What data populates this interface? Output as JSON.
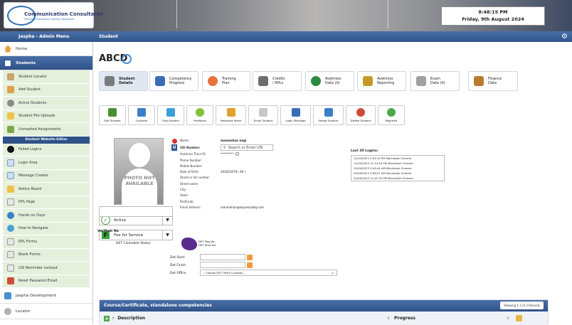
{
  "header": {
    "logo_line1": "Communication Consultants",
    "logo_line2": "Telecommunications Training Specialists",
    "time": "8:48:15 PM",
    "date": "Friday, 9th August 2024"
  },
  "sidebar": {
    "title": "Jaspha - Admin Menu",
    "home": "Home",
    "students": "Students",
    "items": [
      "Student Locator",
      "Add Student",
      "Active Students",
      "Student File Uploads",
      "Unmarked Assignments"
    ],
    "editor_label": "Student Website Editor",
    "editor_items": [
      "Failed Logins",
      "Login Area",
      "Message Creator",
      "Notice Board",
      "RPL Page",
      "Hands on Days",
      "How to Navigate",
      "RPL Forms",
      "Blank Forms",
      "USI Reminder Lockout",
      "Reset Password Email"
    ],
    "bottom": [
      "Jaspha Development",
      "Locator"
    ]
  },
  "main": {
    "section_title": "Student",
    "student_name": "ABCD",
    "tabs": [
      {
        "l1": "Student",
        "l2": "Details",
        "color": "#7b7b7b"
      },
      {
        "l1": "Competency",
        "l2": "Progress",
        "color": "#3a6db5"
      },
      {
        "l1": "Training",
        "l2": "Plan",
        "color": "#e8733a"
      },
      {
        "l1": "Credits",
        "l2": "/ RPLs",
        "color": "#6d6d6d"
      },
      {
        "l1": "Avetmiss",
        "l2": "Data (0)",
        "color": "#2b8a3e"
      },
      {
        "l1": "Avetmiss",
        "l2": "Reporting",
        "color": "#c59a28"
      },
      {
        "l1": "Exam",
        "l2": "Data (0)",
        "color": "#a0a0a0"
      },
      {
        "l1": "Finance",
        "l2": "Data",
        "color": "#b87b2e"
      }
    ],
    "actions": [
      {
        "label": "Edit Student",
        "color": "#4a8f2f"
      },
      {
        "label": "Contacts",
        "color": "#3a7fc7"
      },
      {
        "label": "Flag Student",
        "color": "#3a9fd8"
      },
      {
        "label": "Feedback",
        "color": "#7fc23a"
      },
      {
        "label": "Password Reset",
        "color": "#e0a32a"
      },
      {
        "label": "Email Student",
        "color": "#c7c7c7"
      },
      {
        "label": "Login Message",
        "color": "#3a6db5"
      },
      {
        "label": "Merge Student",
        "color": "#3a7fc7"
      },
      {
        "label": "Delete Student",
        "color": "#d04a3a"
      },
      {
        "label": "Migrated",
        "color": "#4aa84a"
      }
    ],
    "photo_text": "PHOTO NOT AVAILABLE",
    "status": "Active",
    "fee": "Fee for Service",
    "info": [
      {
        "label": "Name:",
        "value": "manmohan negi"
      },
      {
        "label": "USI Number:",
        "value": "Search or Enter USI"
      },
      {
        "label": "Avetmiss Trace ID:",
        "value": "*********"
      },
      {
        "label": "Phone Number:",
        "value": ""
      },
      {
        "label": "Mobile Number:",
        "value": ""
      },
      {
        "label": "Date of Birth:",
        "value": "20/03/1978 ( 46 )"
      },
      {
        "label": "Street or lot number:",
        "value": ""
      },
      {
        "label": "Street name:",
        "value": ""
      },
      {
        "label": "City:",
        "value": ""
      },
      {
        "label": "State:",
        "value": ""
      },
      {
        "label": "PostCode:",
        "value": ""
      },
      {
        "label": "Email Address:",
        "value": "manmohan@expressalley.com"
      }
    ],
    "last_logins_title": "Last 20 Logins:",
    "logins": [
      "12/10/2023 2:44:14 PM  Macintosh  Chrome",
      "12/10/2023 11:14:34 PM  Macintosh  Chrome",
      "25/09/2023 4:09:44 AM  Macintosh  Chrome",
      "25/09/2023 3:56:07 AM  Macintosh  Chrome",
      "24/09/2023 11:41:29 PM  Macintosh  Chrome"
    ],
    "verified": "Verified: No",
    "det_status": "DET Claimable Status",
    "det_reg": "DET Reg No:",
    "det_stud": "DET Stud No:",
    "det_start": "Det Start",
    "det_finish": "Det Finish",
    "det_office": "Det Office",
    "det_office_placeholder": "-- Choose DET Office Location --",
    "course_title": "Course/Certificate, standalone competencies",
    "course_showing": "Showing 1-3 of 3 Records",
    "col_description": "Description",
    "col_progress": "Progress"
  }
}
